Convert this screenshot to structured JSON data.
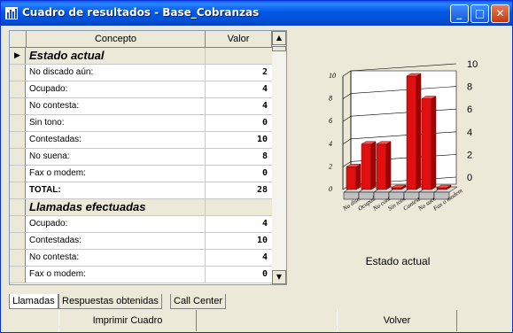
{
  "window": {
    "title": "Cuadro de resultados - Base_Cobranzas",
    "minimize": "_",
    "maximize": "□",
    "close": "✕"
  },
  "grid": {
    "columns": [
      "Concepto",
      "Valor"
    ],
    "rows": [
      {
        "concept": "Estado actual",
        "value": "",
        "kind": "section",
        "current": true
      },
      {
        "concept": "No discado aún:",
        "value": "2",
        "kind": "data"
      },
      {
        "concept": "Ocupado:",
        "value": "4",
        "kind": "data"
      },
      {
        "concept": "No contesta:",
        "value": "4",
        "kind": "data"
      },
      {
        "concept": "Sin tono:",
        "value": "0",
        "kind": "data"
      },
      {
        "concept": "Contestadas:",
        "value": "10",
        "kind": "data"
      },
      {
        "concept": "No suena:",
        "value": "8",
        "kind": "data"
      },
      {
        "concept": "Fax o modem:",
        "value": "0",
        "kind": "data"
      },
      {
        "concept": "TOTAL:",
        "value": "28",
        "kind": "total"
      },
      {
        "concept": "Llamadas efectuadas",
        "value": "",
        "kind": "section"
      },
      {
        "concept": "Ocupado:",
        "value": "4",
        "kind": "data"
      },
      {
        "concept": "Contestadas:",
        "value": "10",
        "kind": "data"
      },
      {
        "concept": "No contesta:",
        "value": "4",
        "kind": "data"
      },
      {
        "concept": "Fax o modem:",
        "value": "0",
        "kind": "data"
      }
    ],
    "scroll_up": "▲",
    "scroll_down": "▼",
    "row_marker": "▶"
  },
  "chart_caption": "Estado actual",
  "chart_data": {
    "type": "bar",
    "title": "",
    "categories": [
      "No discado aún",
      "Ocupado",
      "No contesta",
      "Sin tono",
      "Contestadas",
      "No suena",
      "Fax o modem"
    ],
    "values": [
      2,
      4,
      4,
      0,
      10,
      8,
      0
    ],
    "ylim": [
      0,
      10
    ],
    "yticks": [
      "0",
      "2",
      "4",
      "6",
      "8",
      "10"
    ],
    "style": "3d",
    "bar_color": "#e01010"
  },
  "tabs": [
    "Llamadas",
    "Respuestas obtenidas",
    "Call Center"
  ],
  "active_tab": 0,
  "buttons": {
    "print": "Imprimir Cuadro",
    "back": "Volver"
  }
}
